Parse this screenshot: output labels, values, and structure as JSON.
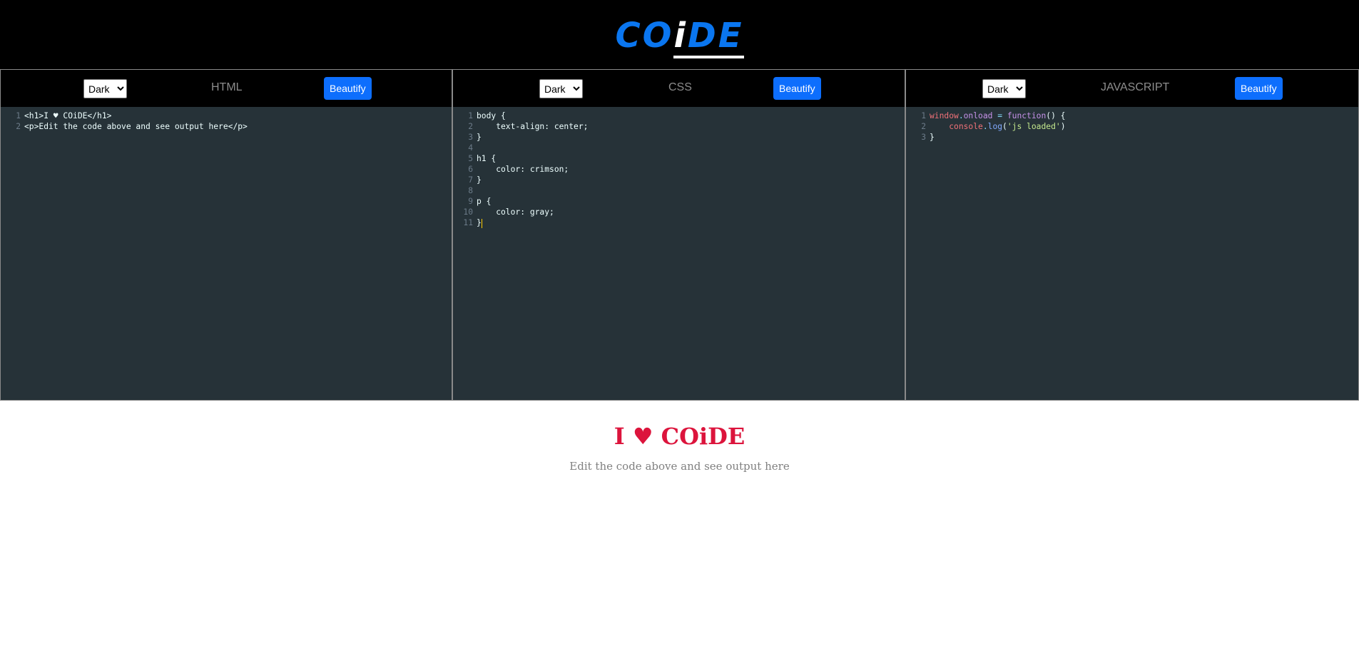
{
  "header": {
    "logo_co": "CO",
    "logo_i": "i",
    "logo_de": "DE"
  },
  "panes": [
    {
      "title": "HTML",
      "theme": "Dark",
      "beautify_label": "Beautify"
    },
    {
      "title": "CSS",
      "theme": "Dark",
      "beautify_label": "Beautify"
    },
    {
      "title": "JAVASCRIPT",
      "theme": "Dark",
      "beautify_label": "Beautify"
    }
  ],
  "html_code": [
    "<h1>I ♥ COiDE</h1>",
    "<p>Edit the code above and see output here</p>"
  ],
  "css_code": [
    "body {",
    "    text-align: center;",
    "}",
    "",
    "h1 {",
    "    color: crimson;",
    "}",
    "",
    "p {",
    "    color: gray;",
    "}"
  ],
  "js_code": {
    "line1": {
      "obj": "window",
      "dot": ".",
      "prop": "onload",
      "eq": " = ",
      "kw": "function",
      "rest": "() {"
    },
    "line2": {
      "indent": "    ",
      "obj": "console",
      "dot": ".",
      "fn": "log",
      "open": "(",
      "str": "'js loaded'",
      "close": ")"
    },
    "line3": "}"
  },
  "output": {
    "heading": "I ♥ COiDE",
    "paragraph": "Edit the code above and see output here"
  },
  "colors": {
    "accent": "#0a76f0",
    "button": "#0d6efd",
    "editor_bg": "#263238",
    "output_heading": "#dc143c"
  }
}
